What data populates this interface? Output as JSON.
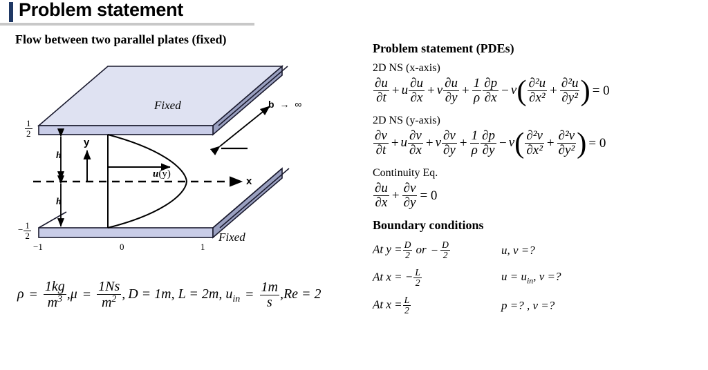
{
  "header": {
    "title": "Problem statement",
    "accent_color": "#1f3864",
    "rule_color": "#c8c8c8"
  },
  "left": {
    "heading": "Flow between two parallel plates (fixed)",
    "diagram": {
      "plate_fill": "#c9cde8",
      "plate_side_fill": "#9aa0c0",
      "plate_top_fill": "#dfe2f2",
      "top_plate_label": "Fixed",
      "bottom_plate_label": "Fixed",
      "depth_label": "b",
      "depth_arrow": "→",
      "depth_value": "∞",
      "y_axis_label": "y",
      "x_axis_label": "x",
      "velocity_label_bold": "u",
      "velocity_label_rest": "(y)",
      "gap_label_top": "h",
      "gap_label_bottom": "h",
      "y_tick_top_num": "1",
      "y_tick_top_den": "2",
      "y_tick_bottom_sign": "−",
      "y_tick_bottom_num": "1",
      "y_tick_bottom_den": "2",
      "x_ticks": [
        "−1",
        "0",
        "1"
      ]
    },
    "parameters": {
      "rho_symbol": "ρ",
      "rho_eq": "=",
      "rho_num": "1kg",
      "rho_den": "m",
      "rho_den_exp": "3",
      "mu_symbol": "μ",
      "mu_eq": "=",
      "mu_num": "1Ns",
      "mu_den": "m",
      "mu_den_exp": "2",
      "D_text": "D = 1m,",
      "L_text": "L = 2m,",
      "uin_symbol": "u",
      "uin_sub": "in",
      "uin_eq": "=",
      "uin_num": "1m",
      "uin_den": "s",
      "Re_text": "Re = 2",
      "comma": ","
    }
  },
  "right": {
    "pde_section_title": "Problem statement (PDEs)",
    "ns_x_label": "2D NS (x-axis)",
    "ns_y_label": "2D NS (y-axis)",
    "continuity_label": "Continuity Eq.",
    "bc_section_title": "Boundary conditions",
    "equations": {
      "ns_x": {
        "t1_num": "∂u",
        "t1_den": "∂t",
        "plus1": "+",
        "u1": "u",
        "t2_num": "∂u",
        "t2_den": "∂x",
        "plus2": "+",
        "v1": "v",
        "t3_num": "∂u",
        "t3_den": "∂y",
        "plus3": "+",
        "t4_num": "1",
        "t4_den": "ρ",
        "t5_num": "∂p",
        "t5_den": "∂x",
        "minus": "−",
        "nu": "ν",
        "lparen": "(",
        "t6_num": "∂²u",
        "t6_den": "∂x²",
        "plus4": "+",
        "t7_num": "∂²u",
        "t7_den": "∂y²",
        "rparen": ")",
        "equals": "= 0"
      },
      "ns_y": {
        "t1_num": "∂v",
        "t1_den": "∂t",
        "plus1": "+",
        "u1": "u",
        "t2_num": "∂v",
        "t2_den": "∂x",
        "plus2": "+",
        "v1": "v",
        "t3_num": "∂v",
        "t3_den": "∂y",
        "plus3": "+",
        "t4_num": "1",
        "t4_den": "ρ",
        "t5_num": "∂p",
        "t5_den": "∂y",
        "minus": "−",
        "nu": "ν",
        "lparen": "(",
        "t6_num": "∂²v",
        "t6_den": "∂x²",
        "plus4": "+",
        "t7_num": "∂²v",
        "t7_den": "∂y²",
        "rparen": ")",
        "equals": "= 0"
      },
      "continuity": {
        "t1_num": "∂u",
        "t1_den": "∂x",
        "plus": "+",
        "t2_num": "∂v",
        "t2_den": "∂y",
        "equals": "= 0"
      }
    },
    "boundary_conditions": [
      {
        "lead": "At y =",
        "num": "D",
        "den": "2",
        "mid": "or",
        "sign": "−",
        "num2": "D",
        "den2": "2",
        "result": "u, v =?"
      },
      {
        "lead": "At x = −",
        "num": "L",
        "den": "2",
        "mid": "",
        "sign": "",
        "num2": "",
        "den2": "",
        "result_a": "u = u",
        "result_sub": "in",
        "result_b": ", v =?"
      },
      {
        "lead": "At x =",
        "num": "L",
        "den": "2",
        "mid": "",
        "sign": "",
        "num2": "",
        "den2": "",
        "result": "p =? , v =?"
      }
    ]
  }
}
